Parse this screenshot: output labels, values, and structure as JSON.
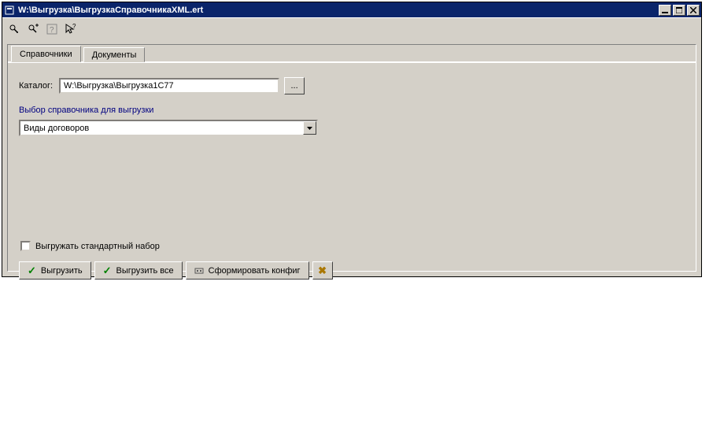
{
  "window": {
    "title": "W:\\Выгрузка\\ВыгрузкаСправочникаXML.ert"
  },
  "tabs": {
    "spravochniki": "Справочники",
    "dokumenty": "Документы"
  },
  "catalog": {
    "label": "Каталог:",
    "value": "W:\\Выгрузка\\Выгрузка1С77",
    "browse": "..."
  },
  "section": {
    "title": "Выбор справочника для выгрузки",
    "selected": "Виды договоров"
  },
  "checkbox": {
    "label": "Выгружать стандартный набор",
    "checked": false
  },
  "buttons": {
    "export": "Выгрузить",
    "export_all": "Выгрузить все",
    "make_config": "Сформировать конфиг"
  }
}
